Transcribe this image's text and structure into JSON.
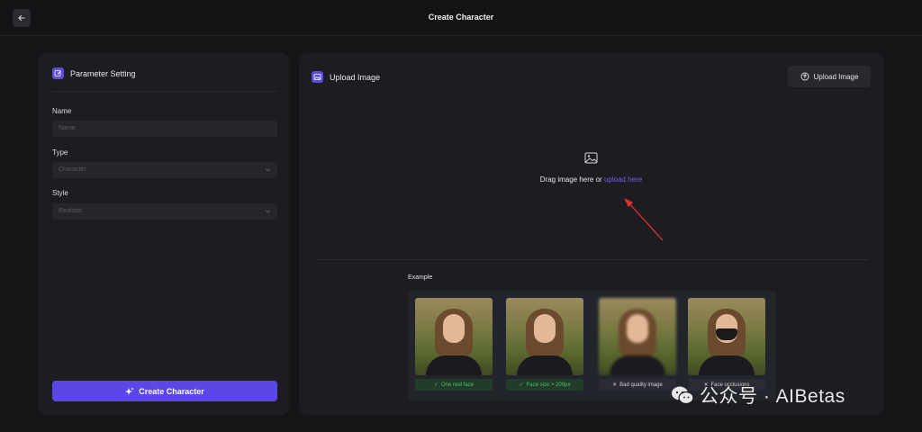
{
  "header": {
    "title": "Create Character",
    "back_icon": "arrow-left-icon"
  },
  "left_panel": {
    "title": "Parameter Setting",
    "fields": {
      "name": {
        "label": "Name",
        "placeholder": "Name"
      },
      "type": {
        "label": "Type",
        "value": "Character"
      },
      "style": {
        "label": "Style",
        "value": "Realistic"
      }
    },
    "create_button": "Create Character"
  },
  "right_panel": {
    "title": "Upload Image",
    "upload_button": "Upload Image",
    "drop_text": "Drag image here or ",
    "drop_link": "upload here",
    "example_label": "Example",
    "examples": [
      {
        "caption": "One real face",
        "status": "ok"
      },
      {
        "caption": "Face size > 200px",
        "status": "ok"
      },
      {
        "caption": "Bad quality image",
        "status": "bad"
      },
      {
        "caption": "Face occlusions",
        "status": "bad"
      }
    ]
  },
  "watermark": "公众号 · AIBetas",
  "colors": {
    "accent": "#5b47e8",
    "link": "#6e60ee",
    "ok": "#46c36b",
    "annotation": "#e0332b"
  }
}
